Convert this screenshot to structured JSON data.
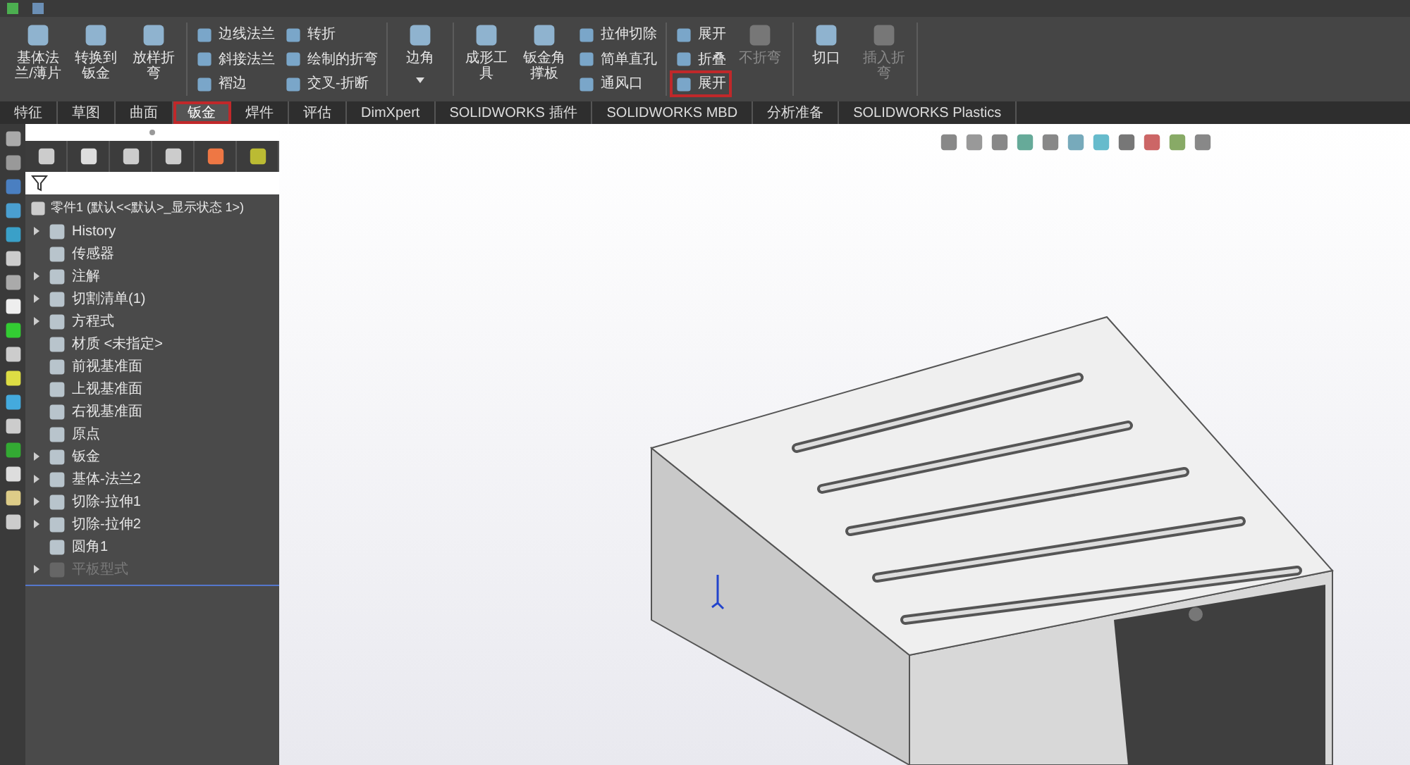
{
  "ribbon": {
    "groups": [
      {
        "items": [
          {
            "kind": "large",
            "label": "基体法兰/薄片",
            "disabled": false,
            "highlighted": false
          },
          {
            "kind": "large",
            "label": "转换到钣金",
            "disabled": false,
            "highlighted": false
          },
          {
            "kind": "large",
            "label": "放样折弯",
            "disabled": false,
            "highlighted": false
          }
        ]
      },
      {
        "items": [
          {
            "kind": "small",
            "label": "边线法兰",
            "disabled": false,
            "highlighted": false
          },
          {
            "kind": "small",
            "label": "斜接法兰",
            "disabled": false,
            "highlighted": false
          },
          {
            "kind": "small",
            "label": "褶边",
            "disabled": false,
            "highlighted": false
          },
          {
            "kind": "small",
            "label": "转折",
            "disabled": false,
            "highlighted": false
          },
          {
            "kind": "small",
            "label": "绘制的折弯",
            "disabled": false,
            "highlighted": false
          },
          {
            "kind": "small",
            "label": "交叉-折断",
            "disabled": false,
            "highlighted": false
          }
        ]
      },
      {
        "items": [
          {
            "kind": "dropdown",
            "label": "边角",
            "disabled": false,
            "highlighted": false
          }
        ]
      },
      {
        "items": [
          {
            "kind": "large",
            "label": "成形工具",
            "disabled": false,
            "highlighted": false
          },
          {
            "kind": "large",
            "label": "钣金角撑板",
            "disabled": false,
            "highlighted": false
          },
          {
            "kind": "small",
            "label": "拉伸切除",
            "disabled": false,
            "highlighted": false
          },
          {
            "kind": "small",
            "label": "简单直孔",
            "disabled": false,
            "highlighted": false
          },
          {
            "kind": "small",
            "label": "通风口",
            "disabled": false,
            "highlighted": false
          }
        ]
      },
      {
        "items": [
          {
            "kind": "small",
            "label": "展开",
            "disabled": false,
            "highlighted": false
          },
          {
            "kind": "small",
            "label": "折叠",
            "disabled": false,
            "highlighted": false
          },
          {
            "kind": "small",
            "label": "展开",
            "disabled": false,
            "highlighted": true
          },
          {
            "kind": "large",
            "label": "不折弯",
            "disabled": true,
            "highlighted": false
          }
        ]
      },
      {
        "items": [
          {
            "kind": "large",
            "label": "切口",
            "disabled": false,
            "highlighted": false
          },
          {
            "kind": "large",
            "label": "插入折弯",
            "disabled": true,
            "highlighted": false
          }
        ]
      }
    ]
  },
  "tabs": [
    {
      "label": "特征",
      "selected": false
    },
    {
      "label": "草图",
      "selected": false
    },
    {
      "label": "曲面",
      "selected": false
    },
    {
      "label": "钣金",
      "selected": true
    },
    {
      "label": "焊件",
      "selected": false
    },
    {
      "label": "评估",
      "selected": false
    },
    {
      "label": "DimXpert",
      "selected": false
    },
    {
      "label": "SOLIDWORKS 插件",
      "selected": false
    },
    {
      "label": "SOLIDWORKS MBD",
      "selected": false
    },
    {
      "label": "分析准备",
      "selected": false
    },
    {
      "label": "SOLIDWORKS Plastics",
      "selected": false
    }
  ],
  "feature_tree": {
    "root": "零件1 (默认<<默认>_显示状态 1>)",
    "children": [
      {
        "label": "History",
        "expandable": true,
        "suppressed": false
      },
      {
        "label": "传感器",
        "expandable": false,
        "suppressed": false
      },
      {
        "label": "注解",
        "expandable": true,
        "suppressed": false
      },
      {
        "label": "切割清单(1)",
        "expandable": true,
        "suppressed": false
      },
      {
        "label": "方程式",
        "expandable": true,
        "suppressed": false
      },
      {
        "label": "材质 <未指定>",
        "expandable": false,
        "suppressed": false
      },
      {
        "label": "前视基准面",
        "expandable": false,
        "suppressed": false
      },
      {
        "label": "上视基准面",
        "expandable": false,
        "suppressed": false
      },
      {
        "label": "右视基准面",
        "expandable": false,
        "suppressed": false
      },
      {
        "label": "原点",
        "expandable": false,
        "suppressed": false
      },
      {
        "label": "钣金",
        "expandable": true,
        "suppressed": false
      },
      {
        "label": "基体-法兰2",
        "expandable": true,
        "suppressed": false
      },
      {
        "label": "切除-拉伸1",
        "expandable": true,
        "suppressed": false
      },
      {
        "label": "切除-拉伸2",
        "expandable": true,
        "suppressed": false
      },
      {
        "label": "圆角1",
        "expandable": false,
        "suppressed": false
      },
      {
        "label": "平板型式",
        "expandable": true,
        "suppressed": true
      }
    ]
  }
}
